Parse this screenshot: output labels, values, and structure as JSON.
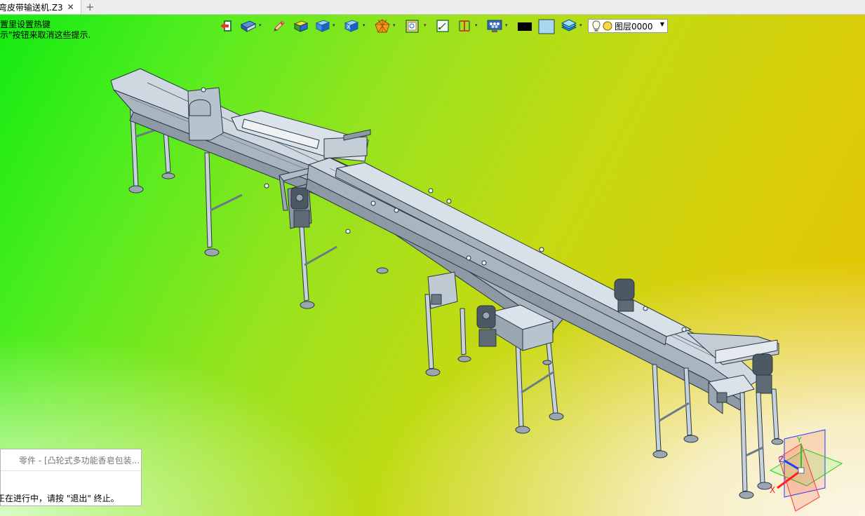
{
  "window": {
    "tab_title": "弯皮带输送机.Z3",
    "close_glyph": "✕",
    "new_tab_glyph": "+"
  },
  "hints": {
    "line1": "置里设置热键",
    "line2": "示\"按钮来取消这些提示."
  },
  "toolbar": {
    "layer_label": "图层0000",
    "dropdown_glyph": "▾",
    "layer_dropdown_glyph": "▼",
    "icons": [
      "exit-icon",
      "view-display-icon",
      "pen-icon",
      "box-icon",
      "cube-icon",
      "view-orient-icon",
      "render-mode-icon",
      "clipboard-view-icon",
      "fit-view-icon",
      "dimension-icon",
      "display-filter-icon",
      "color-swatch-black",
      "color-swatch-blue",
      "layer-stack-icon",
      "bulb-icon",
      "sun-icon"
    ],
    "colors": {
      "swatch_black": "#000000",
      "swatch_blue": "#a8d8ef"
    }
  },
  "bottom_panel": {
    "title": "零件 - [凸轮式多功能香皂包装...",
    "message": "正在进行中，请按 \"退出\" 终止。"
  },
  "triad": {
    "x_label": "X",
    "y_label": "Y",
    "z_label": "Z"
  },
  "colors": {
    "background_start": "#12ec12",
    "background_end": "#e6c000",
    "conveyor_body": "#9fb0bf",
    "conveyor_edge": "#2b3642"
  }
}
